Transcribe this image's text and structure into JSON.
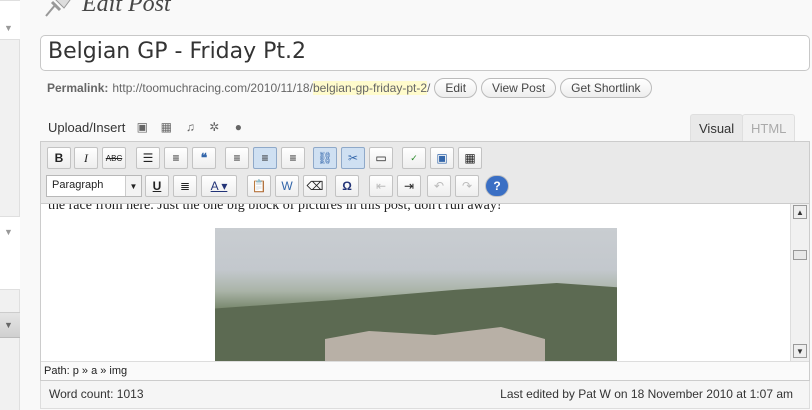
{
  "heading": "Edit Post",
  "post_title": "Belgian GP - Friday Pt.2",
  "permalink": {
    "label": "Permalink:",
    "base": "http://toomuchracing.com/2010/11/18/",
    "slug": "belgian-gp-friday-pt-2",
    "suffix": "/",
    "buttons": [
      "Edit",
      "View Post",
      "Get Shortlink"
    ]
  },
  "media": {
    "label": "Upload/Insert",
    "icons": [
      "add-image-icon",
      "add-video-icon",
      "add-audio-icon",
      "add-media-icon",
      "add-gallery-icon"
    ]
  },
  "tabs": {
    "visual": "Visual",
    "html": "HTML"
  },
  "toolbar": {
    "row1": [
      "bold",
      "italic",
      "strikethrough",
      "bullet-list",
      "numbered-list",
      "blockquote",
      "align-left",
      "align-center",
      "align-right",
      "insert-link",
      "unlink",
      "insert-more",
      "spellcheck",
      "fullscreen",
      "kitchen-sink"
    ],
    "format_select": "Paragraph",
    "row2": [
      "underline",
      "justify",
      "text-color",
      "paste-text",
      "paste-word",
      "remove-format",
      "special-character",
      "outdent",
      "indent",
      "undo",
      "redo",
      "help"
    ]
  },
  "content_text": "the race from here. Just the one big block of pictures in this post, don't run away!",
  "path": "Path: p » a » img",
  "status": {
    "word_count": "Word count: 1013",
    "last_edited": "Last edited by Pat W on 18 November 2010 at 1:07 am"
  }
}
